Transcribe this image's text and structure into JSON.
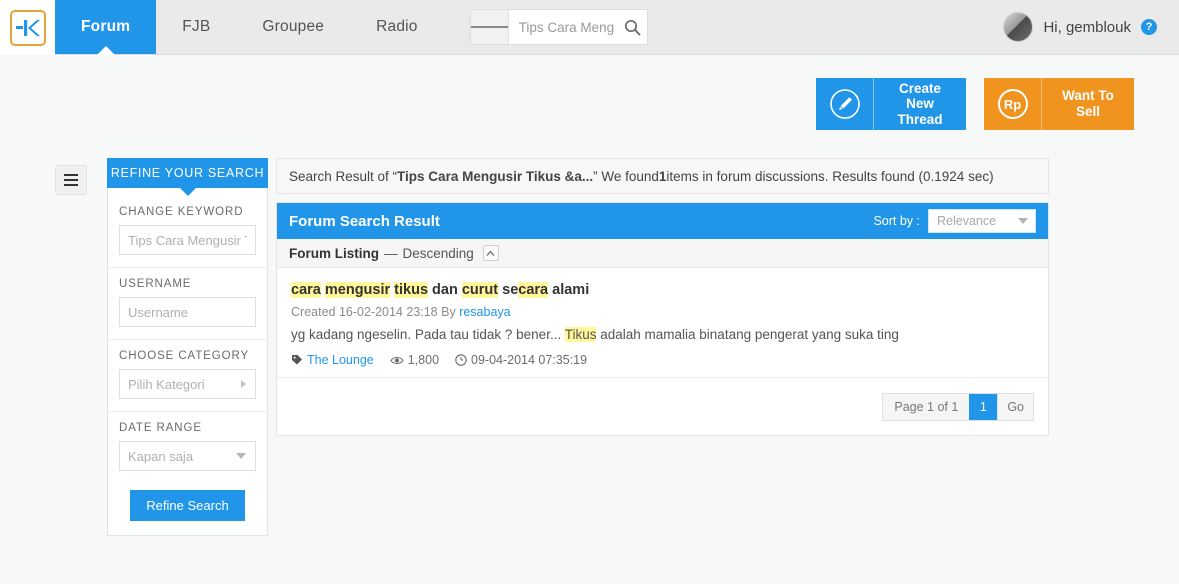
{
  "header": {
    "logo_alt": "kaskus-logo",
    "nav": [
      {
        "label": "Forum",
        "active": true
      },
      {
        "label": "FJB",
        "active": false
      },
      {
        "label": "Groupee",
        "active": false
      },
      {
        "label": "Radio",
        "active": false
      }
    ],
    "search": {
      "value": "Tips Cara Meng",
      "placeholder": "Search"
    },
    "user": {
      "greeting": "Hi, gemblouk",
      "help_badge": "?"
    }
  },
  "actions": [
    {
      "label": "Create New Thread",
      "icon": "pencil-icon",
      "color": "#2196e8"
    },
    {
      "label": "Want To Sell",
      "icon": "rupiah-icon",
      "color": "#f0941f"
    }
  ],
  "sidebar": {
    "tab_title": "REFINE YOUR SEARCH",
    "blocks": [
      {
        "label": "CHANGE KEYWORD",
        "type": "input",
        "value": "",
        "placeholder": "Tips Cara Mengusir T"
      },
      {
        "label": "USERNAME",
        "type": "input",
        "value": "",
        "placeholder": "Username"
      },
      {
        "label": "CHOOSE CATEGORY",
        "type": "select-right",
        "value": "Pilih Kategori"
      },
      {
        "label": "DATE RANGE",
        "type": "select-down",
        "value": "Kapan saja"
      }
    ],
    "submit_label": "Refine Search"
  },
  "main": {
    "result_note": {
      "prefix": "Search Result of “",
      "query": "Tips Cara Mengusir Tikus &a...",
      "middle": "” We found ",
      "count": "1",
      "suffix": " items in forum discussions. Results found (0.1924 sec)"
    },
    "panel_title": "Forum Search Result",
    "sort_by_label": "Sort by :",
    "sort_by_value": "Relevance",
    "listing_label": "Forum Listing",
    "listing_dash": "—",
    "listing_direction": "Descending",
    "results": [
      {
        "title_parts": [
          {
            "text": "cara",
            "highlight": true
          },
          {
            "text": " ",
            "highlight": false
          },
          {
            "text": "mengusir",
            "highlight": true
          },
          {
            "text": " ",
            "highlight": false
          },
          {
            "text": "tikus",
            "highlight": true
          },
          {
            "text": " dan ",
            "highlight": false
          },
          {
            "text": "curut",
            "highlight": true
          },
          {
            "text": " se",
            "highlight": false
          },
          {
            "text": "cara",
            "highlight": true
          },
          {
            "text": " alami",
            "highlight": false
          }
        ],
        "created_prefix": "Created 16-02-2014 23:18 By ",
        "author": "resabaya",
        "snippet_parts": [
          {
            "text": "yg kadang ngeselin. Pada tau tidak ? bener... ",
            "highlight": false
          },
          {
            "text": "Tikus",
            "highlight": true
          },
          {
            "text": " adalah mamalia binatang pengerat yang suka ting",
            "highlight": false
          }
        ],
        "category": "The Lounge",
        "views": "1,800",
        "timestamp": "09-04-2014 07:35:19"
      }
    ],
    "pager": {
      "label": "Page 1 of 1",
      "current": "1",
      "go_label": "Go"
    }
  }
}
